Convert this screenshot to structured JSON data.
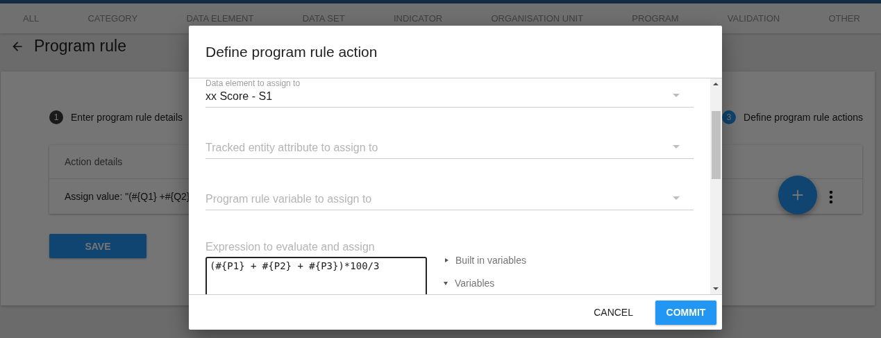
{
  "nav_tabs": [
    "ALL",
    "CATEGORY",
    "DATA ELEMENT",
    "DATA SET",
    "INDICATOR",
    "ORGANISATION UNIT",
    "PROGRAM",
    "VALIDATION",
    "OTHER"
  ],
  "page": {
    "title": "Program rule"
  },
  "steps": [
    {
      "number": "1",
      "label": "Enter program rule details",
      "selected": false
    },
    {
      "number": "3",
      "label": "Define program rule actions",
      "selected": true
    }
  ],
  "actions_table": {
    "columns": [
      "Action details"
    ],
    "rows": [
      {
        "text": "Assign value: \"(#{Q1} +#{Q2}"
      }
    ]
  },
  "save_button": "SAVE",
  "dialog": {
    "title": "Define program rule action",
    "fields": [
      {
        "kind": "select",
        "label": "Data element to assign to",
        "value": "xx Score - S1"
      },
      {
        "kind": "select",
        "placeholder": "Tracked entity attribute to assign to"
      },
      {
        "kind": "select",
        "placeholder": "Program rule variable to assign to"
      }
    ],
    "expression": {
      "label": "Expression to evaluate and assign",
      "value": "(#{P1} + #{P2} + #{P3})*100/3"
    },
    "variable_groups": [
      {
        "label": "Built in variables",
        "expanded": false
      },
      {
        "label": "Variables",
        "expanded": true
      }
    ],
    "buttons": [
      {
        "label": "CANCEL",
        "kind": "flat"
      },
      {
        "label": "COMMIT",
        "kind": "raised"
      }
    ]
  }
}
